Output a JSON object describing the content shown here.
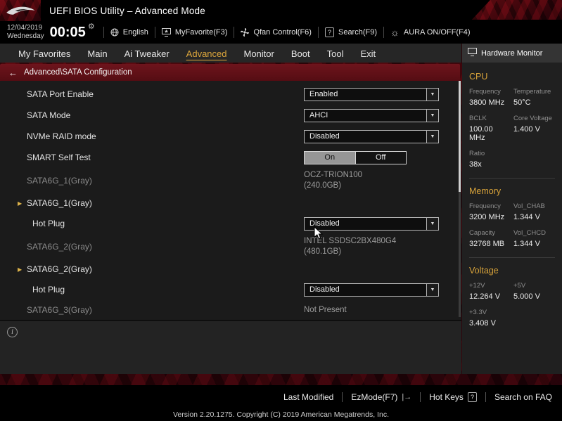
{
  "titlebar": {
    "title": "UEFI BIOS Utility – Advanced Mode"
  },
  "toolbar": {
    "date": "12/04/2019",
    "weekday": "Wednesday",
    "time": "00:05",
    "language": "English",
    "my_favorite": "MyFavorite(F3)",
    "qfan": "Qfan Control(F6)",
    "search": "Search(F9)",
    "aura": "AURA ON/OFF(F4)"
  },
  "icons": {
    "gear": "⚙",
    "aura_glyph": "☼",
    "question": "?",
    "chevron": "▼",
    "expand": "▶",
    "back": "←",
    "info": "i"
  },
  "nav": {
    "tabs": [
      "My Favorites",
      "Main",
      "Ai Tweaker",
      "Advanced",
      "Monitor",
      "Boot",
      "Tool",
      "Exit"
    ],
    "active": "Advanced"
  },
  "breadcrumb": {
    "path": "Advanced\\SATA Configuration"
  },
  "settings": {
    "rows": [
      {
        "label": "SATA Port Enable",
        "value": "Enabled"
      },
      {
        "label": "SATA Mode",
        "value": "AHCI"
      },
      {
        "label": "NVMe RAID mode",
        "value": "Disabled"
      },
      {
        "label": "SMART Self Test",
        "on": "On",
        "off": "Off"
      },
      {
        "label": "SATA6G_1(Gray)",
        "value": "OCZ-TRION100",
        "size": "(240.0GB)"
      },
      {
        "label": "SATA6G_1(Gray)"
      },
      {
        "label": "Hot Plug",
        "value": "Disabled"
      },
      {
        "label": "SATA6G_2(Gray)",
        "value": "INTEL SSDSC2BX480G4",
        "size": "(480.1GB)"
      },
      {
        "label": "SATA6G_2(Gray)"
      },
      {
        "label": "Hot Plug",
        "value": "Disabled"
      },
      {
        "label": "SATA6G_3(Gray)",
        "value": "Not Present"
      }
    ]
  },
  "hardware_monitor": {
    "title": "Hardware Monitor",
    "cpu": {
      "heading": "CPU",
      "stats": [
        {
          "label": "Frequency",
          "value": "3800 MHz"
        },
        {
          "label": "Temperature",
          "value": "50°C"
        },
        {
          "label": "BCLK",
          "value": "100.00 MHz"
        },
        {
          "label": "Core Voltage",
          "value": "1.400 V"
        },
        {
          "label": "Ratio",
          "value": "38x"
        }
      ]
    },
    "memory": {
      "heading": "Memory",
      "stats": [
        {
          "label": "Frequency",
          "value": "3200 MHz"
        },
        {
          "label": "Vol_CHAB",
          "value": "1.344 V"
        },
        {
          "label": "Capacity",
          "value": "32768 MB"
        },
        {
          "label": "Vol_CHCD",
          "value": "1.344 V"
        }
      ]
    },
    "voltage": {
      "heading": "Voltage",
      "stats": [
        {
          "label": "+12V",
          "value": "12.264 V"
        },
        {
          "label": "+5V",
          "value": "5.000 V"
        },
        {
          "label": "+3.3V",
          "value": "3.408 V"
        }
      ]
    }
  },
  "footer": {
    "last_modified": "Last Modified",
    "ezmode": "EzMode(F7)",
    "ezmode_icon": "|→",
    "hot_keys": "Hot Keys",
    "hot_keys_badge": "?",
    "faq": "Search on FAQ",
    "version": "Version 2.20.1275. Copyright (C) 2019 American Megatrends, Inc."
  }
}
